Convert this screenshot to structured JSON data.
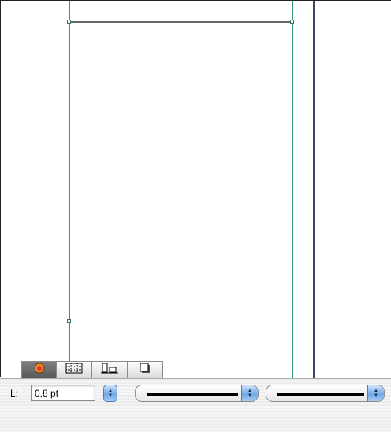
{
  "canvas": {
    "guide_color": "#2e9b76",
    "margin_color": "#222222",
    "edge_color": "#3b4a6b",
    "rule_color": "#666666"
  },
  "tabs": [
    {
      "name": "color",
      "icon": "color-wheel-icon",
      "active": true
    },
    {
      "name": "grid",
      "icon": "grid-icon",
      "active": false
    },
    {
      "name": "align",
      "icon": "align-icon",
      "active": false
    },
    {
      "name": "shadow",
      "icon": "shadow-icon",
      "active": false
    }
  ],
  "stroke": {
    "label": "L:",
    "width_value": "0,8 pt"
  },
  "accent": "#6fa8e6"
}
